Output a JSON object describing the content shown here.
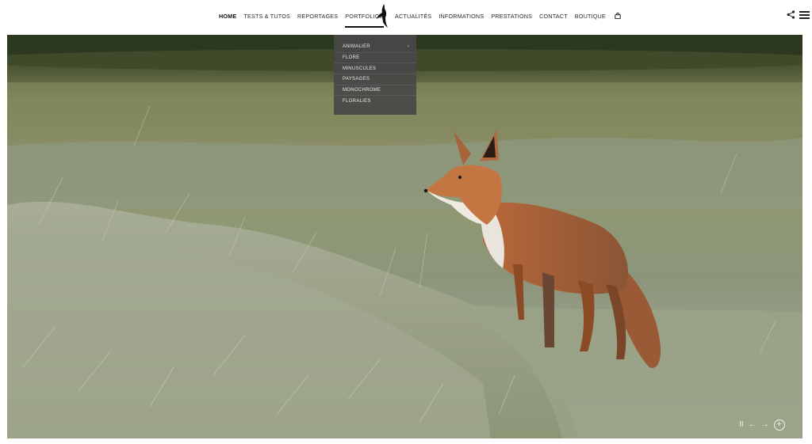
{
  "nav": {
    "left": [
      "HOME",
      "TESTS & TUTOS",
      "REPORTAGES",
      "PORTFOLIOS"
    ],
    "right": [
      "ACTUALITÉS",
      "INFORMATIONS",
      "PRESTATIONS",
      "CONTACT",
      "BOUTIQUE"
    ],
    "active": "HOME",
    "open": "PORTFOLIOS"
  },
  "icons": {
    "logo": "bird-logo-icon",
    "cart": "shopping-bag-icon",
    "share": "share-icon",
    "menu": "hamburger-menu-icon",
    "pause": "pause-icon",
    "prev": "arrow-left-icon",
    "next": "arrow-right-icon",
    "zoom": "plus-circle-icon"
  },
  "dropdown": {
    "items": [
      {
        "label": "ANIMALIER",
        "arrow": "›"
      },
      {
        "label": "FLORE",
        "arrow": ""
      },
      {
        "label": "MINUSCULES",
        "arrow": ""
      },
      {
        "label": "PAYSAGES",
        "arrow": ""
      },
      {
        "label": "MONOCHROME",
        "arrow": ""
      },
      {
        "label": "FLORALIES",
        "arrow": ""
      }
    ]
  },
  "slideshow": {
    "pause": "II",
    "prev": "←",
    "next": "→",
    "zoom": "+"
  },
  "colors": {
    "nav_text": "#2a2a2a",
    "dropdown_bg": "#484848",
    "fox": "#9a5a35"
  }
}
